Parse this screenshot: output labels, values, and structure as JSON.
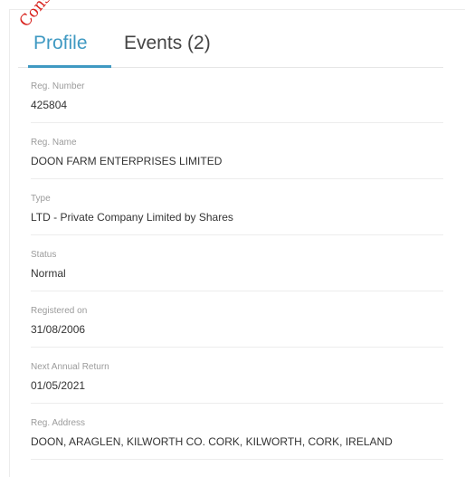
{
  "stamp_text": "Consent",
  "tabs": [
    {
      "label": "Profile",
      "active": true
    },
    {
      "label": "Events (2)",
      "active": false
    }
  ],
  "fields": [
    {
      "label": "Reg. Number",
      "value": "425804"
    },
    {
      "label": "Reg. Name",
      "value": "DOON FARM ENTERPRISES LIMITED"
    },
    {
      "label": "Type",
      "value": "LTD - Private Company Limited by Shares"
    },
    {
      "label": "Status",
      "value": "Normal"
    },
    {
      "label": "Registered on",
      "value": "31/08/2006"
    },
    {
      "label": "Next Annual Return",
      "value": "01/05/2021"
    },
    {
      "label": "Reg. Address",
      "value": "DOON, ARAGLEN, KILWORTH CO. CORK, KILWORTH, CORK, IRELAND"
    }
  ],
  "colors": {
    "accent": "#3f99c2",
    "stamp": "#d8211c"
  }
}
